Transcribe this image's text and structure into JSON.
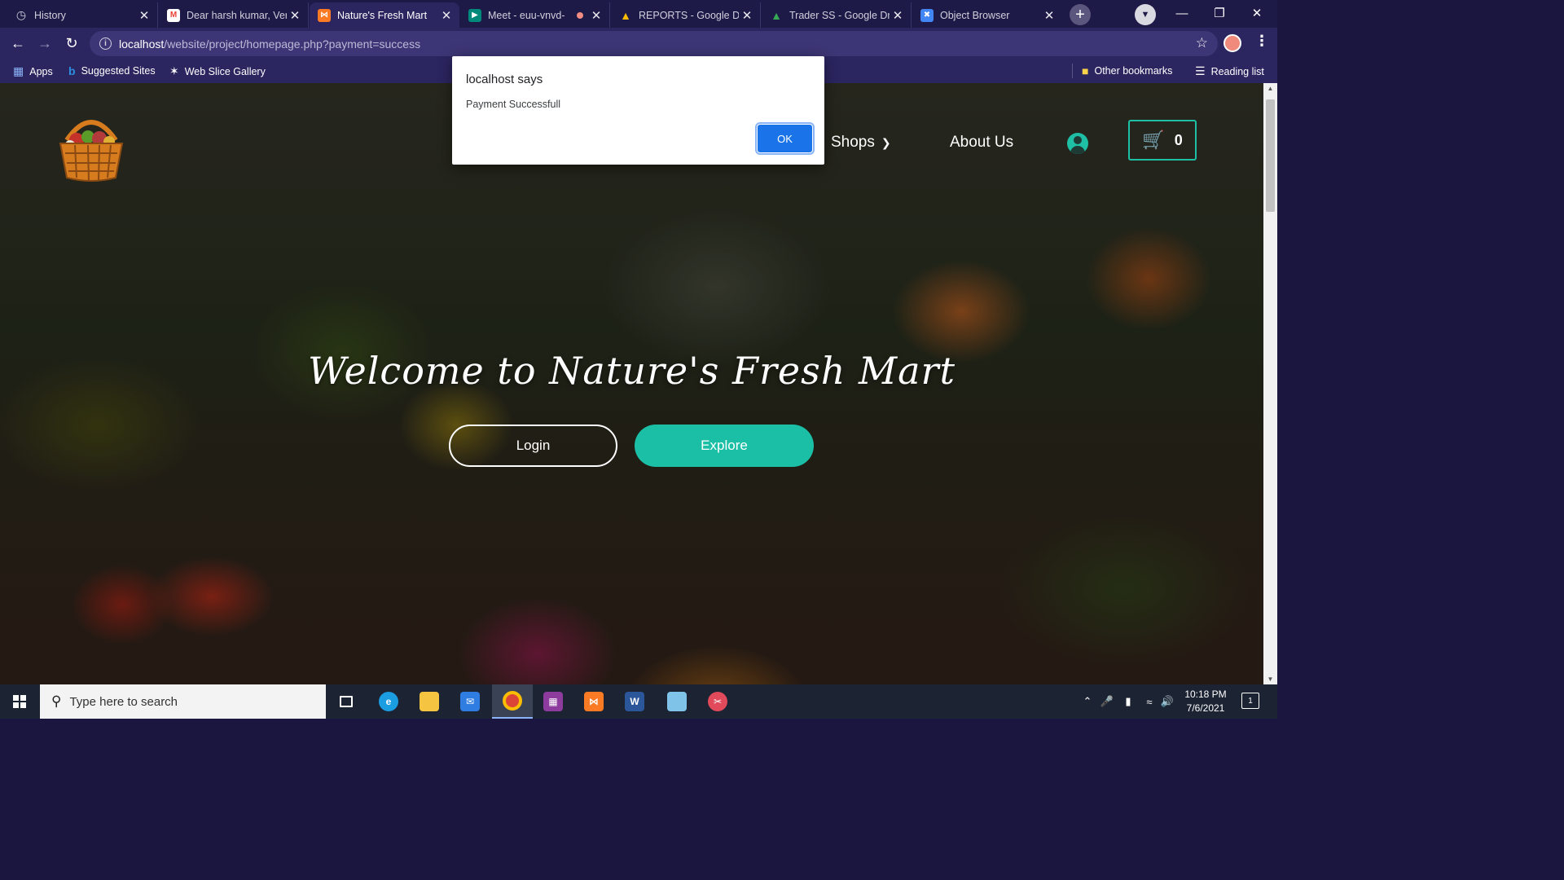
{
  "browser": {
    "tabs": [
      {
        "label": "History",
        "icon": "history-icon",
        "color": "#9aa0a6",
        "active": false
      },
      {
        "label": "Dear harsh kumar, Ver",
        "icon": "gmail-icon",
        "color": "#ea4335",
        "active": false
      },
      {
        "label": "Nature's Fresh Mart",
        "icon": "xampp-icon",
        "color": "#fb7a24",
        "active": true
      },
      {
        "label": "Meet - euu-vnvd-",
        "icon": "meet-icon",
        "color": "#00897b",
        "active": false
      },
      {
        "label": "REPORTS - Google Dri",
        "icon": "google-drive-icon",
        "color": "#fbbc04",
        "active": false
      },
      {
        "label": "Trader SS - Google Dr",
        "icon": "google-drive-icon",
        "color": "#34a853",
        "active": false
      },
      {
        "label": "Object Browser",
        "icon": "object-browser-icon",
        "color": "#4285f4",
        "active": false
      }
    ],
    "url_host": "localhost",
    "url_path": "/website/project/homepage.php?payment=success",
    "bookmarks": [
      {
        "label": "Apps",
        "icon": "apps-grid-icon"
      },
      {
        "label": "Suggested Sites",
        "icon": "bing-icon"
      },
      {
        "label": "Web Slice Gallery",
        "icon": "web-slice-icon"
      }
    ],
    "other_bookmarks": "Other bookmarks",
    "reading_list": "Reading list"
  },
  "site": {
    "nav": {
      "shops": "Shops",
      "about": "About Us",
      "cart_count": "0"
    },
    "hero": {
      "title": "Welcome to Nature's Fresh Mart",
      "login": "Login",
      "explore": "Explore"
    },
    "accent_color": "#1bbfa6"
  },
  "dialog": {
    "title": "localhost says",
    "message": "Payment Successfull",
    "ok": "OK"
  },
  "taskbar": {
    "search_placeholder": "Type here to search",
    "time": "10:18 PM",
    "date": "7/6/2021",
    "notification_count": "1"
  }
}
